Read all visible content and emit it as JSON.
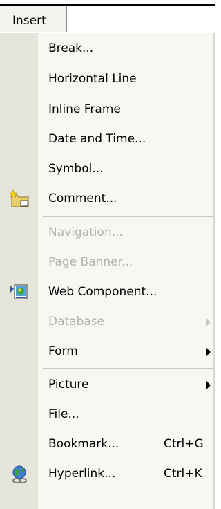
{
  "menu_bar": {
    "title": "Insert"
  },
  "items": {
    "break": {
      "label": "Break..."
    },
    "horizontal_line": {
      "label": "Horizontal Line"
    },
    "inline_frame": {
      "label": "Inline Frame"
    },
    "date_time": {
      "label": "Date and Time..."
    },
    "symbol": {
      "label": "Symbol..."
    },
    "comment": {
      "label": "Comment...",
      "icon": "comment-icon"
    },
    "navigation": {
      "label": "Navigation...",
      "disabled": true
    },
    "page_banner": {
      "label": "Page Banner...",
      "disabled": true
    },
    "web_component": {
      "label": "Web Component...",
      "icon": "web-component-icon"
    },
    "database": {
      "label": "Database",
      "disabled": true
    },
    "form": {
      "label": "Form"
    },
    "picture": {
      "label": "Picture"
    },
    "file": {
      "label": "File..."
    },
    "bookmark": {
      "label": "Bookmark...",
      "shortcut": "Ctrl+G"
    },
    "hyperlink": {
      "label": "Hyperlink...",
      "shortcut": "Ctrl+K",
      "icon": "hyperlink-icon"
    }
  },
  "colors": {
    "gutter": "#e6e5dc",
    "menu_background": "#f7f7f4",
    "disabled_text": "#b3b2aa",
    "separator": "#c9c8bf"
  }
}
